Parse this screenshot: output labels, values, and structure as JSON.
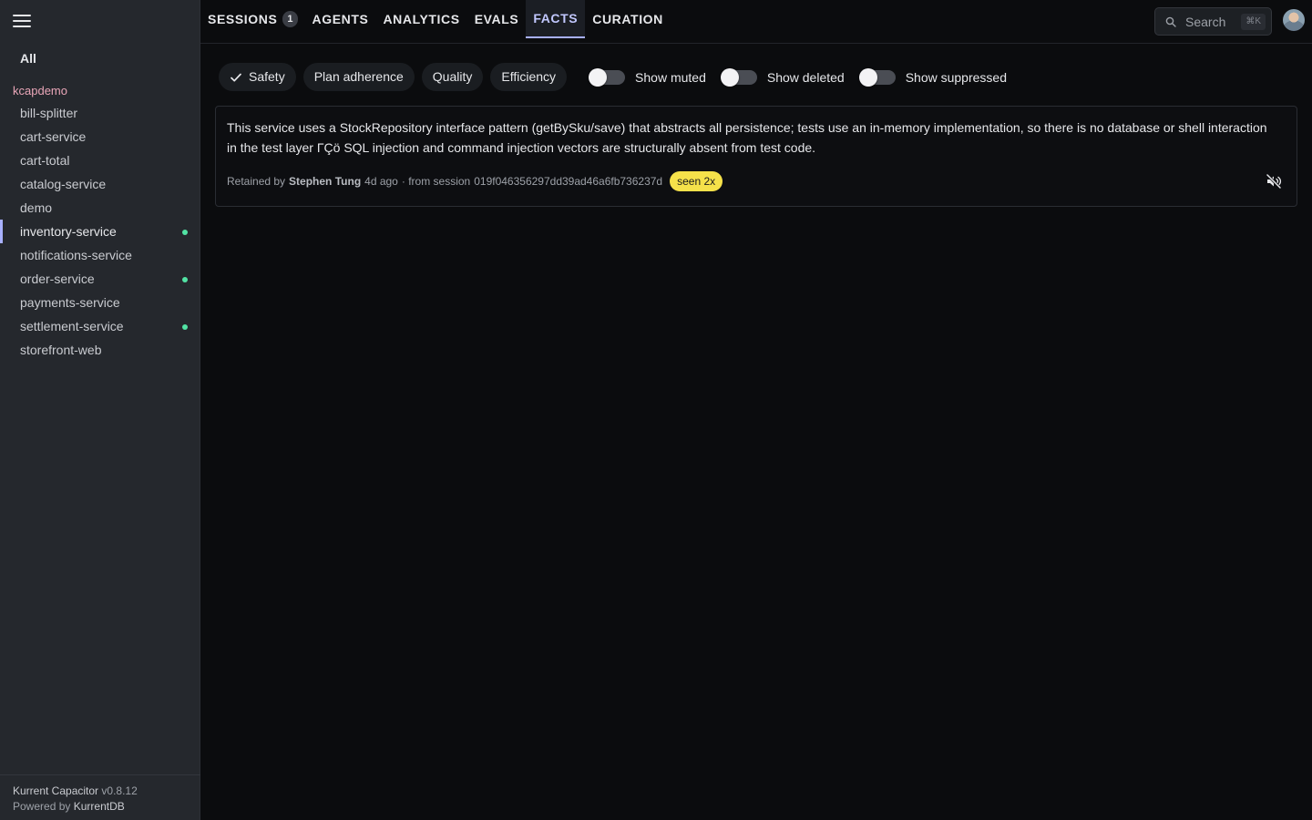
{
  "sidebar": {
    "all_label": "All",
    "group": "kcapdemo",
    "items": [
      {
        "label": "bill-splitter",
        "dot": false,
        "active": false
      },
      {
        "label": "cart-service",
        "dot": false,
        "active": false
      },
      {
        "label": "cart-total",
        "dot": false,
        "active": false
      },
      {
        "label": "catalog-service",
        "dot": false,
        "active": false
      },
      {
        "label": "demo",
        "dot": false,
        "active": false
      },
      {
        "label": "inventory-service",
        "dot": true,
        "active": true
      },
      {
        "label": "notifications-service",
        "dot": false,
        "active": false
      },
      {
        "label": "order-service",
        "dot": true,
        "active": false
      },
      {
        "label": "payments-service",
        "dot": false,
        "active": false
      },
      {
        "label": "settlement-service",
        "dot": true,
        "active": false
      },
      {
        "label": "storefront-web",
        "dot": false,
        "active": false
      }
    ],
    "footer": {
      "product": "Kurrent Capacitor",
      "version": "v0.8.12",
      "powered_prefix": "Powered by",
      "powered_link": "KurrentDB"
    }
  },
  "header": {
    "tabs": [
      {
        "label": "SESSIONS",
        "badge": "1",
        "active": false
      },
      {
        "label": "AGENTS",
        "badge": null,
        "active": false
      },
      {
        "label": "ANALYTICS",
        "badge": null,
        "active": false
      },
      {
        "label": "EVALS",
        "badge": null,
        "active": false
      },
      {
        "label": "FACTS",
        "badge": null,
        "active": true
      },
      {
        "label": "CURATION",
        "badge": null,
        "active": false
      }
    ],
    "search": {
      "placeholder": "Search",
      "shortcut": "⌘K"
    }
  },
  "filters": {
    "chips": [
      {
        "label": "Safety",
        "checked": true
      },
      {
        "label": "Plan adherence",
        "checked": false
      },
      {
        "label": "Quality",
        "checked": false
      },
      {
        "label": "Efficiency",
        "checked": false
      }
    ],
    "toggles": [
      {
        "label": "Show muted",
        "on": false
      },
      {
        "label": "Show deleted",
        "on": false
      },
      {
        "label": "Show suppressed",
        "on": false
      }
    ]
  },
  "fact": {
    "text": "This service uses a StockRepository interface pattern (getBySku/save) that abstracts all persistence; tests use an in-memory implementation, so there is no database or shell interaction in the test layer ΓÇö SQL injection and command injection vectors are structurally absent from test code.",
    "retained_prefix": "Retained by",
    "author": "Stephen Tung",
    "age": "4d ago",
    "session_prefix": "· from session",
    "session_id": "019f046356297dd39ad46a6fb736237d",
    "seen": "seen 2x"
  },
  "colors": {
    "accent": "#a8b0ff",
    "status_dot": "#52e3a4",
    "seen_badge": "#f5e14a",
    "group_label": "#e9a6b8"
  }
}
